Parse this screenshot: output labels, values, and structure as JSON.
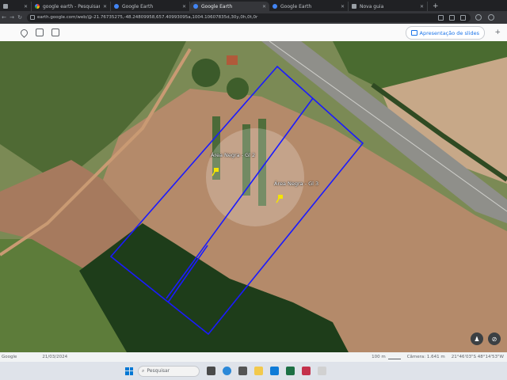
{
  "browser": {
    "tabs": [
      {
        "label": "",
        "favicon": "page-icon"
      },
      {
        "label": "google earth - Pesquisar",
        "favicon": "google-icon"
      },
      {
        "label": "Google Earth",
        "favicon": "earth-icon"
      },
      {
        "label": "Google Earth",
        "favicon": "earth-icon",
        "active": true
      },
      {
        "label": "Google Earth",
        "favicon": "earth-icon"
      },
      {
        "label": "Nova guia",
        "favicon": "page-icon"
      }
    ],
    "new_tab_label": "+",
    "url": "earth.google.com/web/@-21.76735275,-48.24809958,657.40993095a,1004.10607835d,30y,0h,0t,0r"
  },
  "earth_toolbar": {
    "slides_button_label": "Apresentação de slides",
    "add_label": "+"
  },
  "map": {
    "placemarks": [
      {
        "label": "Área Negra - Gl 2"
      },
      {
        "label": "Área Negra - Gl 3"
      }
    ],
    "boundary_color": "#1a1aff",
    "pin_color": "#f4e400"
  },
  "status_bar": {
    "left": "Google",
    "date": "21/03/2024",
    "scale": "100 m",
    "camera": "Câmera: 1.641 m",
    "coords": "21°46'03\"S 48°14'53\"W"
  },
  "taskbar": {
    "search_placeholder": "Pesquisar"
  }
}
